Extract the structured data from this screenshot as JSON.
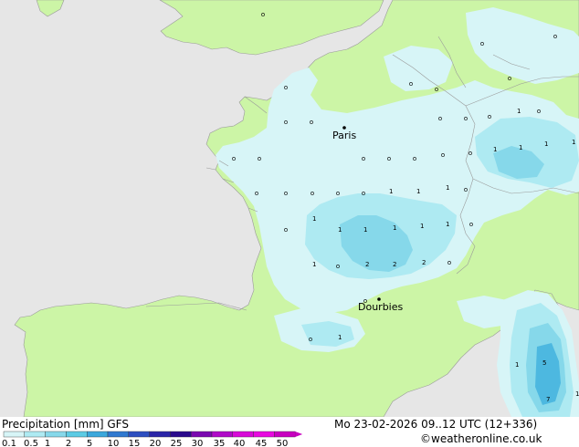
{
  "map": {
    "cities": [
      {
        "name": "Paris"
      },
      {
        "name": "Dourbies"
      }
    ],
    "precip_values": [
      "1",
      "1",
      "1",
      "1",
      "1",
      "1",
      "1",
      "1",
      "1",
      "1",
      "1",
      "1",
      "1",
      "1",
      "1",
      "2",
      "2",
      "2",
      "1",
      "1",
      "5",
      "7",
      "1"
    ],
    "colors": {
      "land": "#ccf5a6",
      "sea": "#e6e6e6",
      "precip_light": "#d7f5f7",
      "precip_mid": "#aeeaf2",
      "precip_heavy": "#86d8ea",
      "precip_strong": "#4db8e0"
    }
  },
  "footer": {
    "title": "Precipitation [mm]  GFS",
    "datetime": "Mo 23-02-2026 09..12 UTC (12+336)",
    "credit": "©weatheronline.co.uk"
  },
  "legend": {
    "ticks": [
      "0.1",
      "0.5",
      "1",
      "2",
      "5",
      "10",
      "15",
      "20",
      "25",
      "30",
      "35",
      "40",
      "45",
      "50"
    ],
    "colors": [
      "#d7f5f7",
      "#aeeaf2",
      "#86d8ea",
      "#5ccbe4",
      "#3ba8dc",
      "#3079d0",
      "#2d4fc0",
      "#2a25a8",
      "#2a0a8c",
      "#7a08b0",
      "#b00ac8",
      "#d80ad8",
      "#e80ae0",
      "#c800c0"
    ]
  }
}
